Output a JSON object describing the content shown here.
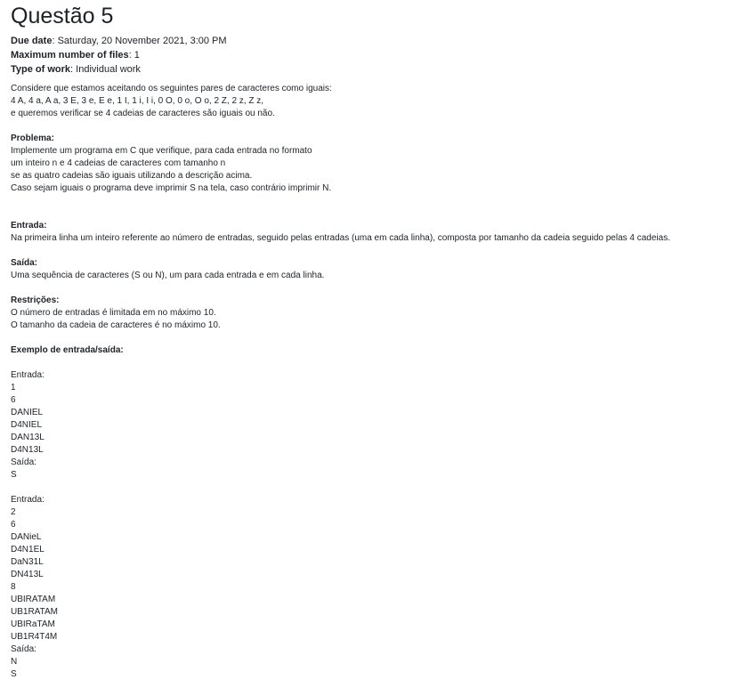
{
  "title": "Questão 5",
  "meta": [
    {
      "label": "Due date",
      "value": "Saturday, 20 November 2021, 3:00 PM"
    },
    {
      "label": "Maximum number of files",
      "value": "1"
    },
    {
      "label": "Type of work",
      "value": "Individual work"
    }
  ],
  "description": [
    {
      "text": "Considere que estamos aceitando os seguintes pares de caracteres como iguais:",
      "bold": false
    },
    {
      "text": "4 A, 4 a, A a, 3 E, 3 e, E e, 1 I, 1 i, I i, 0 O, 0 o, O o, 2 Z, 2 z, Z z,",
      "bold": false
    },
    {
      "text": "e queremos verificar se 4 cadeias de caracteres são iguais ou não.",
      "bold": false
    },
    {
      "text": "",
      "bold": false
    },
    {
      "text": "Problema:",
      "bold": true
    },
    {
      "text": "Implemente um programa em C que verifique, para cada entrada no formato",
      "bold": false
    },
    {
      "text": "um inteiro n e 4 cadeias de caracteres com tamanho n",
      "bold": false
    },
    {
      "text": "se as quatro cadeias são iguais utilizando a descrição acima.",
      "bold": false
    },
    {
      "text": "Caso sejam iguais o programa deve imprimir S na tela, caso contrário imprimir N.",
      "bold": false
    },
    {
      "text": "",
      "bold": false
    },
    {
      "text": "",
      "bold": false
    },
    {
      "text": "Entrada:",
      "bold": true
    },
    {
      "text": "Na primeira linha um inteiro referente ao número de entradas, seguido pelas entradas (uma em cada linha), composta por tamanho da cadeia seguido pelas 4 cadeias.",
      "bold": false
    },
    {
      "text": "",
      "bold": false
    },
    {
      "text": "Saída:",
      "bold": true
    },
    {
      "text": "Uma sequência de caracteres (S ou N), um para cada entrada e em cada linha.",
      "bold": false
    },
    {
      "text": "",
      "bold": false
    },
    {
      "text": "Restrições:",
      "bold": true
    },
    {
      "text": "O número de entradas é limitada em no máximo 10.",
      "bold": false
    },
    {
      "text": "O tamanho da cadeia de caracteres é no máximo 10.",
      "bold": false
    },
    {
      "text": "",
      "bold": false
    },
    {
      "text": "Exemplo de entrada/saída:",
      "bold": true
    },
    {
      "text": "",
      "bold": false
    },
    {
      "text": "Entrada:",
      "bold": false
    },
    {
      "text": "1",
      "bold": false
    },
    {
      "text": "6",
      "bold": false
    },
    {
      "text": "DANIEL",
      "bold": false
    },
    {
      "text": "D4NIEL",
      "bold": false
    },
    {
      "text": "DAN13L",
      "bold": false
    },
    {
      "text": "D4N13L",
      "bold": false
    },
    {
      "text": "Saída:",
      "bold": false
    },
    {
      "text": "S",
      "bold": false
    },
    {
      "text": "",
      "bold": false
    },
    {
      "text": "Entrada:",
      "bold": false
    },
    {
      "text": "2",
      "bold": false
    },
    {
      "text": "6",
      "bold": false
    },
    {
      "text": "DANieL",
      "bold": false
    },
    {
      "text": "D4N1EL",
      "bold": false
    },
    {
      "text": "DaN31L",
      "bold": false
    },
    {
      "text": "DN413L",
      "bold": false
    },
    {
      "text": "8",
      "bold": false
    },
    {
      "text": "UBIRATAM",
      "bold": false
    },
    {
      "text": "UB1RATAM",
      "bold": false
    },
    {
      "text": "UBIRaTAM",
      "bold": false
    },
    {
      "text": "UB1R4T4M",
      "bold": false
    },
    {
      "text": "Saída:",
      "bold": false
    },
    {
      "text": "N",
      "bold": false
    },
    {
      "text": "S",
      "bold": false
    }
  ]
}
